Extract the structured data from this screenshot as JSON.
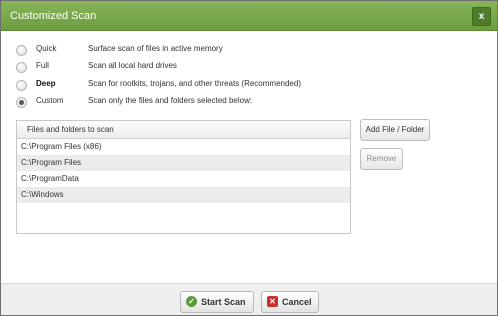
{
  "dialog": {
    "title": "Customized Scan",
    "close_label": "x"
  },
  "options": [
    {
      "name": "Quick",
      "desc": "Surface scan of files in active memory",
      "checked": false,
      "bold": false
    },
    {
      "name": "Full",
      "desc": "Scan all local hard drives",
      "checked": false,
      "bold": false
    },
    {
      "name": "Deep",
      "desc": "Scan for rootkits, trojans, and other threats (Recommended)",
      "checked": false,
      "bold": true
    },
    {
      "name": "Custom",
      "desc": "Scan only the files and folders selected below:",
      "checked": true,
      "bold": false
    }
  ],
  "files": {
    "header": "Files and folders to scan",
    "rows": [
      "C:\\Program Files (x86)",
      "C:\\Program Files",
      "C:\\ProgramData",
      "C:\\Windows"
    ]
  },
  "side_buttons": {
    "add": "Add File / Folder",
    "remove": "Remove"
  },
  "footer": {
    "start": "Start Scan",
    "cancel": "Cancel"
  },
  "colors": {
    "titlebar": "#7aa84b",
    "accent_ok": "#5d9a3a",
    "accent_cancel": "#c9302c"
  }
}
